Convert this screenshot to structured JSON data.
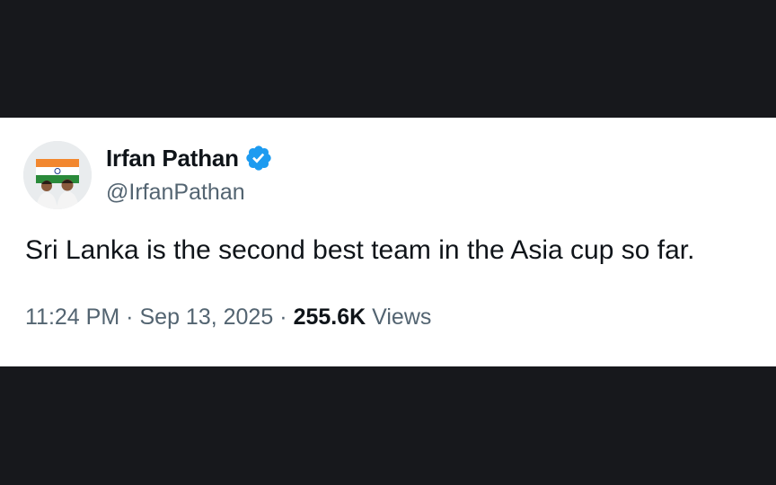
{
  "tweet": {
    "author": {
      "display_name": "Irfan Pathan",
      "handle": "@IrfanPathan",
      "verified": true,
      "verified_color": "#1d9bf0",
      "avatar_icon": "avatar-two-men-with-indian-flag"
    },
    "text": "Sri Lanka is the second best team in the Asia cup so far.",
    "time": "11:24 PM",
    "separator": "·",
    "date": "Sep 13, 2025",
    "views_count": "255.6K",
    "views_label": "Views"
  },
  "colors": {
    "background_band": "#17181c",
    "card_background": "#ffffff",
    "primary_text": "#0f1419",
    "secondary_text": "#536471"
  }
}
